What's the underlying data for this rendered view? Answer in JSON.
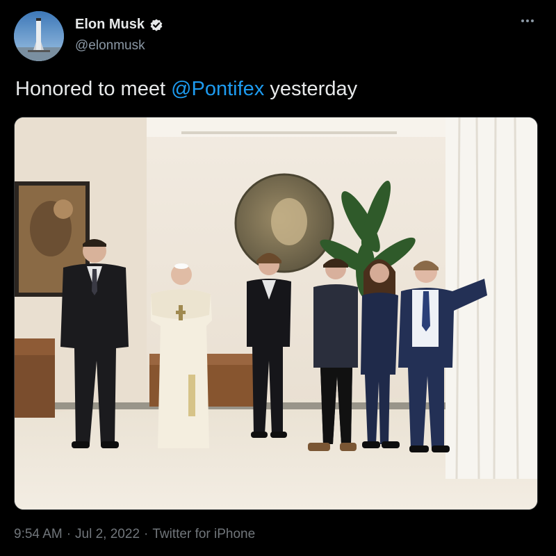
{
  "author": {
    "display_name": "Elon Musk",
    "handle": "@elonmusk",
    "verified_icon": "verified-badge-icon",
    "avatar_icon": "rocket-avatar"
  },
  "tweet": {
    "text_before": "Honored to meet ",
    "mention": "@Pontifex",
    "text_after": " yesterday"
  },
  "meta": {
    "time": "9:54 AM",
    "separator": "·",
    "date": "Jul 2, 2022",
    "source": "Twitter for iPhone"
  },
  "icons": {
    "more": "more-horizontal-icon"
  },
  "colors": {
    "background": "#000000",
    "text": "#e7e9ea",
    "secondary": "#71767b",
    "link": "#1d9bf0"
  }
}
